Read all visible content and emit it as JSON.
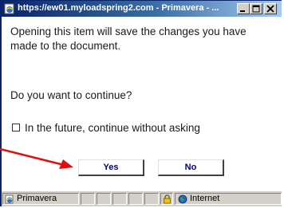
{
  "window": {
    "title": "https://ew01.myloadspring2.com - Primavera - ..."
  },
  "dialog": {
    "message": "Opening this item will save the changes you have made to the document.",
    "question": "Do you want to continue?",
    "checkbox_label": "In the future, continue without asking",
    "checkbox_checked": false,
    "yes_label": "Yes",
    "no_label": "No"
  },
  "statusbar": {
    "page_label": "Primavera",
    "zone_label": "Internet"
  },
  "colors": {
    "titlebar_start": "#0a246a",
    "titlebar_end": "#a6caf0",
    "button_text": "#000080",
    "annotation_arrow": "#e01010",
    "chrome": "#d4d0c8"
  },
  "icons": [
    "ie-page-icon",
    "minimize-icon",
    "maximize-icon",
    "close-icon",
    "lock-icon",
    "globe-icon",
    "annotation-arrow"
  ]
}
